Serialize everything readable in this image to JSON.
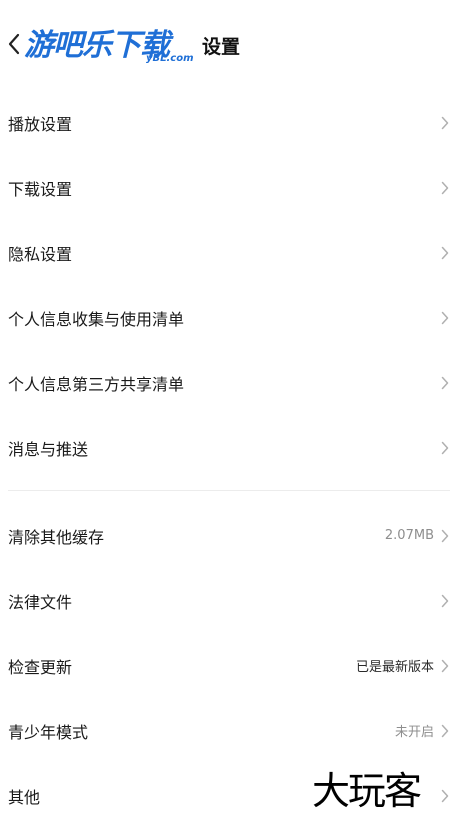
{
  "header": {
    "logo_text": "游吧乐下载",
    "logo_subtext": "yBL.com",
    "title": "设置"
  },
  "group1": [
    {
      "label": "播放设置"
    },
    {
      "label": "下载设置"
    },
    {
      "label": "隐私设置"
    },
    {
      "label": "个人信息收集与使用清单"
    },
    {
      "label": "个人信息第三方共享清单"
    },
    {
      "label": "消息与推送"
    }
  ],
  "group2": [
    {
      "label": "清除其他缓存",
      "value": "2.07MB"
    },
    {
      "label": "法律文件",
      "value": ""
    },
    {
      "label": "检查更新",
      "value": "已是最新版本"
    },
    {
      "label": "青少年模式",
      "value": "未开启"
    },
    {
      "label": "其他",
      "value": ""
    }
  ],
  "watermark": "大玩客",
  "icons": {
    "back": "chevron-left-icon",
    "row": "chevron-right-icon"
  },
  "colors": {
    "logo": "#1f6fd6",
    "text": "#1a1a1a",
    "secondary": "#8e8e8e",
    "chevron": "#b0b0b0",
    "divider": "#ececec"
  }
}
